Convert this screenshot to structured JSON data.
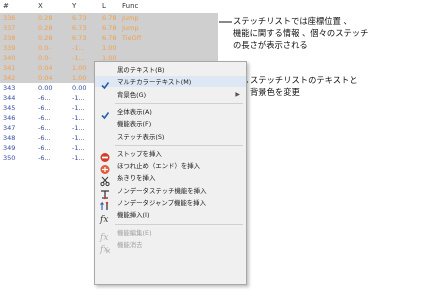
{
  "headers": [
    "#",
    "X",
    "Y",
    "L",
    "Func"
  ],
  "rows": [
    {
      "n": "336",
      "x": "0.28",
      "y": "6.73",
      "l": "6.78",
      "f": "Jump",
      "c": "#f0a050",
      "bg": "#cfcfcf"
    },
    {
      "n": "337",
      "x": "0.28",
      "y": "6.73",
      "l": "6.78",
      "f": "Jump",
      "c": "#f0a050",
      "bg": "#cfcfcf"
    },
    {
      "n": "338",
      "x": "0.28",
      "y": "6.73",
      "l": "6.78",
      "f": "TieOff",
      "c": "#f0a050",
      "bg": "#cfcfcf"
    },
    {
      "n": "339",
      "x": "0.0-",
      "y": "-1...",
      "l": "1.00",
      "f": "",
      "c": "#f0a050",
      "bg": "#cfcfcf"
    },
    {
      "n": "340",
      "x": "0.0-",
      "y": "-1...",
      "l": "1.00",
      "f": "",
      "c": "#f0a050",
      "bg": "#cfcfcf"
    },
    {
      "n": "341",
      "x": "0.04",
      "y": "1.00",
      "l": "1.00",
      "f": "",
      "c": "#f0a050",
      "bg": "#cfcfcf"
    },
    {
      "n": "342",
      "x": "0.04",
      "y": "1.00",
      "l": "1.00",
      "f": "",
      "c": "#f0a050",
      "bg": "#cfcfcf"
    },
    {
      "n": "343",
      "x": "0.00",
      "y": "0.00",
      "l": "",
      "f": "",
      "c": "#3a4aa0",
      "bg": "#ffffff"
    },
    {
      "n": "344",
      "x": "-6...",
      "y": "-1...",
      "l": "",
      "f": "",
      "c": "#3a4aa0",
      "bg": "#ffffff"
    },
    {
      "n": "345",
      "x": "-6...",
      "y": "-1...",
      "l": "",
      "f": "",
      "c": "#3a4aa0",
      "bg": "#ffffff"
    },
    {
      "n": "346",
      "x": "-6...",
      "y": "-1...",
      "l": "",
      "f": "",
      "c": "#3a4aa0",
      "bg": "#ffffff"
    },
    {
      "n": "347",
      "x": "-6...",
      "y": "-1...",
      "l": "",
      "f": "",
      "c": "#3a4aa0",
      "bg": "#ffffff"
    },
    {
      "n": "348",
      "x": "-6...",
      "y": "-1...",
      "l": "",
      "f": "",
      "c": "#3a4aa0",
      "bg": "#ffffff"
    },
    {
      "n": "349",
      "x": "-6...",
      "y": "-1...",
      "l": "",
      "f": "",
      "c": "#3a4aa0",
      "bg": "#ffffff"
    },
    {
      "n": "350",
      "x": "-6...",
      "y": "-1...",
      "l": "",
      "f": "",
      "c": "#3a4aa0",
      "bg": "#ffffff"
    }
  ],
  "menu": [
    {
      "label": "黒のテキスト(B)",
      "icon": "",
      "type": "item"
    },
    {
      "label": "マルチカラーテキスト(M)",
      "icon": "check-icon",
      "type": "item",
      "highlight": true
    },
    {
      "label": "背景色(G)",
      "icon": "",
      "type": "item",
      "submenu": true
    },
    {
      "type": "sep"
    },
    {
      "label": "全体表示(A)",
      "icon": "check-icon",
      "type": "item"
    },
    {
      "label": "機能表示(F)",
      "icon": "",
      "type": "item"
    },
    {
      "label": "ステッチ表示(S)",
      "icon": "",
      "type": "item"
    },
    {
      "type": "sep"
    },
    {
      "label": "ストップを挿入",
      "icon": "stop-icon",
      "type": "item"
    },
    {
      "label": "ほつれ止め（エンド）を挿入",
      "icon": "tie-off-icon",
      "type": "item"
    },
    {
      "label": "糸きりを挿入",
      "icon": "trim-icon",
      "type": "item"
    },
    {
      "label": "ノンデータステッチ機能を挿入",
      "icon": "non-data-stitch-icon",
      "type": "item"
    },
    {
      "label": "ノンデータジャンプ機能を挿入",
      "icon": "non-data-jump-icon",
      "type": "item"
    },
    {
      "label": "機能挿入(I)",
      "icon": "function-insert-icon",
      "type": "item"
    },
    {
      "type": "sep"
    },
    {
      "label": "機能編集(E)",
      "icon": "function-edit-icon",
      "type": "item",
      "disabled": true
    },
    {
      "label": "機能消去",
      "icon": "function-delete-icon",
      "type": "item",
      "disabled": true
    }
  ],
  "annotations": {
    "top": [
      "ステッチリストでは座標位置 、",
      "機能に関する情報 、個々のステッチ",
      "の長さが表示される"
    ],
    "middle": [
      "ステッチリストのテキストと",
      "背景色を変更"
    ]
  }
}
